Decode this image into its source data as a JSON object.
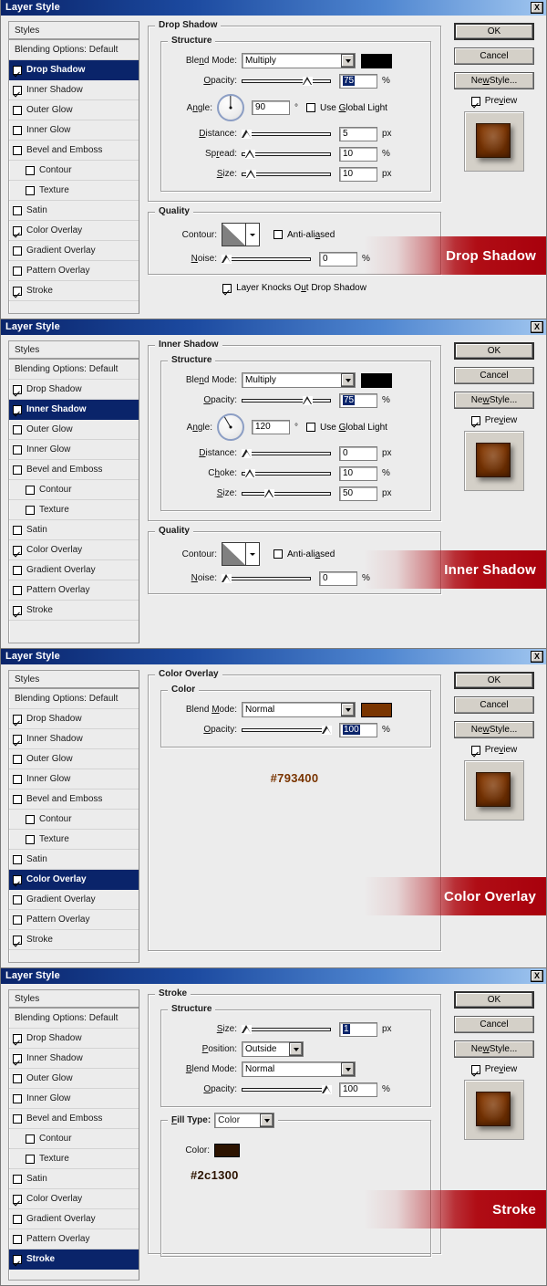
{
  "window": {
    "title": "Layer Style",
    "close_icon": "close-icon",
    "close_label": "X"
  },
  "styles_panel": {
    "header": "Styles",
    "blending_options": "Blending Options: Default",
    "items": [
      {
        "label": "Drop Shadow",
        "checked": true,
        "indent": false
      },
      {
        "label": "Inner Shadow",
        "checked": true,
        "indent": false
      },
      {
        "label": "Outer Glow",
        "checked": false,
        "indent": false
      },
      {
        "label": "Inner Glow",
        "checked": false,
        "indent": false
      },
      {
        "label": "Bevel and Emboss",
        "checked": false,
        "indent": false
      },
      {
        "label": "Contour",
        "checked": false,
        "indent": true
      },
      {
        "label": "Texture",
        "checked": false,
        "indent": true
      },
      {
        "label": "Satin",
        "checked": false,
        "indent": false
      },
      {
        "label": "Color Overlay",
        "checked": true,
        "indent": false
      },
      {
        "label": "Gradient Overlay",
        "checked": false,
        "indent": false
      },
      {
        "label": "Pattern Overlay",
        "checked": false,
        "indent": false
      },
      {
        "label": "Stroke",
        "checked": true,
        "indent": false
      }
    ]
  },
  "buttons": {
    "ok": "OK",
    "cancel": "Cancel",
    "new_style": "New Style...",
    "preview": "Preview"
  },
  "labels": {
    "blend_mode": "Blend Mode:",
    "opacity": "Opacity:",
    "angle": "Angle:",
    "degree": "°",
    "use_global_light": "Use Global Light",
    "distance": "Distance:",
    "spread": "Spread:",
    "choke": "Choke:",
    "size": "Size:",
    "contour": "Contour:",
    "anti_aliased": "Anti-aliased",
    "noise": "Noise:",
    "layer_knocks_out": "Layer Knocks Out Drop Shadow",
    "structure": "Structure",
    "quality": "Quality",
    "color": "Color",
    "position": "Position:",
    "fill_type": "Fill Type:",
    "color_field": "Color:",
    "unit_px": "px",
    "unit_pct": "%"
  },
  "panels": [
    {
      "id": "drop-shadow",
      "banner": "Drop Shadow",
      "selected_style": "Drop Shadow",
      "group_title": "Drop Shadow",
      "blend_mode": "Multiply",
      "blend_color": "#000000",
      "opacity": "75",
      "opacity_selected": true,
      "opacity_pct": 75,
      "angle": "90",
      "angle_deg": 90,
      "use_global_light": false,
      "distance": "5",
      "distance_pct": 2,
      "spread": "10",
      "spread_pct": 4,
      "size": "10",
      "size_pct": 5,
      "noise": "0",
      "noise_pct": 0,
      "anti_aliased": false,
      "layer_knocks_out": true
    },
    {
      "id": "inner-shadow",
      "banner": "Inner Shadow",
      "selected_style": "Inner Shadow",
      "group_title": "Inner Shadow",
      "blend_mode": "Multiply",
      "blend_color": "#000000",
      "opacity": "75",
      "opacity_selected": true,
      "opacity_pct": 75,
      "angle": "120",
      "angle_deg": 120,
      "use_global_light": false,
      "distance": "0",
      "distance_pct": 0,
      "choke": "10",
      "choke_pct": 4,
      "size": "50",
      "size_pct": 26,
      "noise": "0",
      "noise_pct": 0,
      "anti_aliased": false
    },
    {
      "id": "color-overlay",
      "banner": "Color Overlay",
      "selected_style": "Color Overlay",
      "group_title": "Color Overlay",
      "sub_group": "Color",
      "blend_mode": "Normal",
      "blend_color": "#793400",
      "opacity": "100",
      "opacity_selected": true,
      "opacity_pct": 100,
      "hex_label": "#793400",
      "hex_color": "#793400"
    },
    {
      "id": "stroke",
      "banner": "Stroke",
      "selected_style": "Stroke",
      "group_title": "Stroke",
      "size": "1",
      "size_selected": true,
      "size_pct": 1,
      "position": "Outside",
      "blend_mode": "Normal",
      "opacity": "100",
      "opacity_pct": 100,
      "fill_type": "Color",
      "color_swatch": "#2c1300",
      "hex_label": "#2c1300",
      "hex_color": "#2c1300"
    }
  ],
  "theme": {
    "banner_red": "#b00d15",
    "title_blue": "#0a246a",
    "selection_blue": "#0a246a",
    "dialog_gray": "#ececec",
    "button_face": "#d4d0c8",
    "preview_brown": "#7b3503"
  }
}
